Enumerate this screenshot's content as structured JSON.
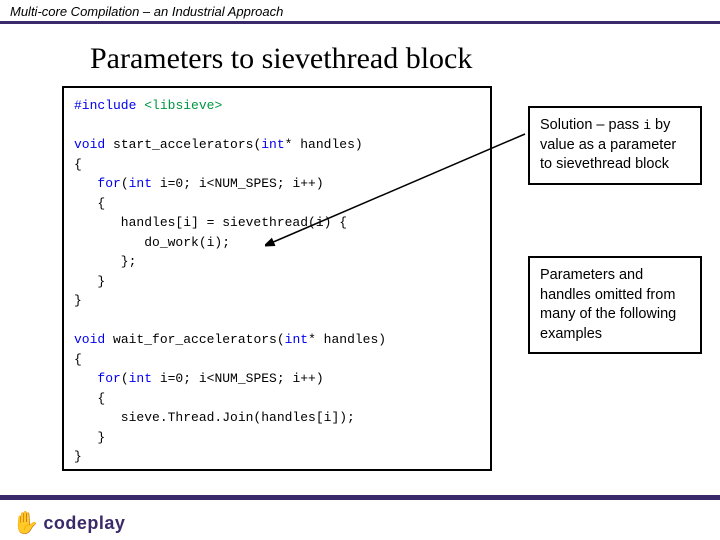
{
  "header": {
    "tagline": "Multi-core Compilation – an Industrial Approach"
  },
  "title": "Parameters to sievethread block",
  "code": {
    "l1a": "#include",
    "l1b": "<libsieve>",
    "l2a": "void",
    "l2b": " start_accelerators(",
    "l2c": "int",
    "l2d": "* handles)",
    "l3": "{",
    "l4a": "   for",
    "l4b": "(",
    "l4c": "int",
    "l4d": " i=0; i<NUM_SPES; i++)",
    "l5": "   {",
    "l6": "      handles[i] = sievethread(i) {",
    "l7": "         do_work(i);",
    "l8": "      };",
    "l9": "   }",
    "l10": "}",
    "l11a": "void",
    "l11b": " wait_for_accelerators(",
    "l11c": "int",
    "l11d": "* handles)",
    "l12": "{",
    "l13a": "   for",
    "l13b": "(",
    "l13c": "int",
    "l13d": " i=0; i<NUM_SPES; i++)",
    "l14": "   {",
    "l15": "      sieve.Thread.Join(handles[i]);",
    "l16": "   }",
    "l17": "}"
  },
  "callouts": {
    "c1_pre": "Solution – pass ",
    "c1_mono": "i",
    "c1_post": " by value as a parameter to sievethread block",
    "c2": "Parameters and handles omitted from many of the following examples"
  },
  "logo": {
    "hand": "✋",
    "text": "codeplay"
  }
}
